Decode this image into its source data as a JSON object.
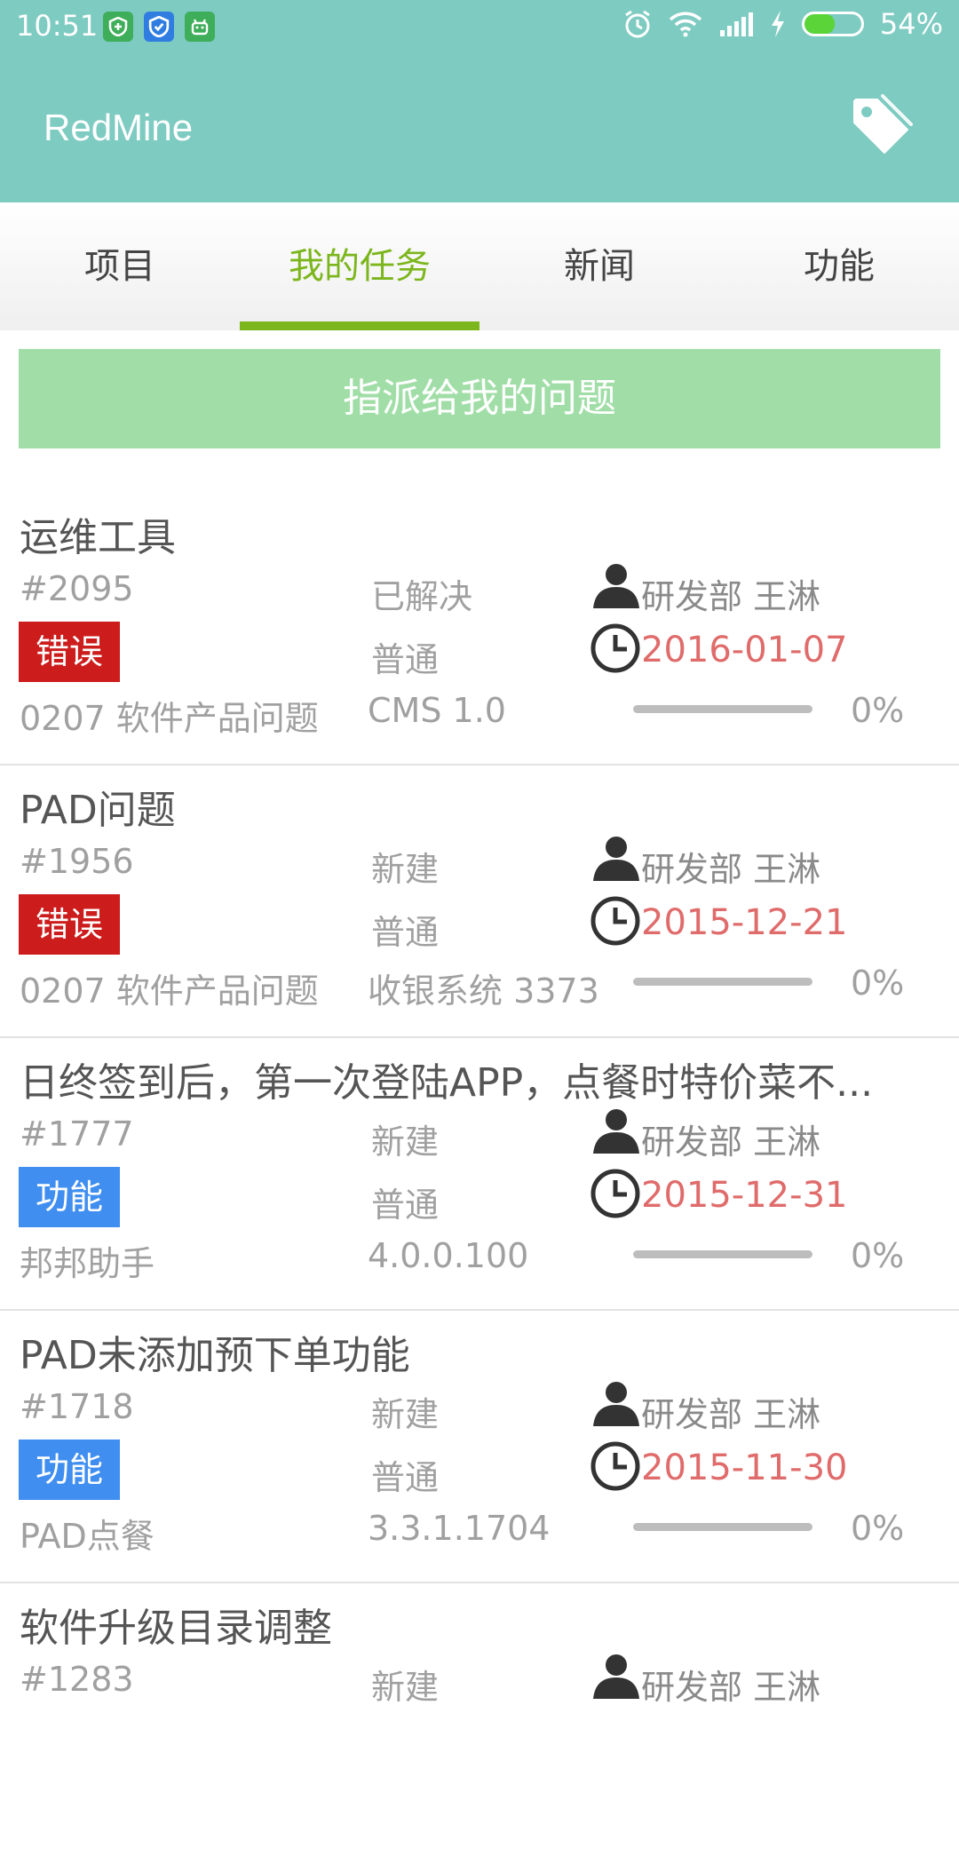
{
  "status_bar": {
    "time": "10:51",
    "battery_text": "54%",
    "battery_level": 0.54,
    "left_icons": [
      "shield-plus-icon",
      "shield-check-icon",
      "android-icon"
    ],
    "right_icons": [
      "alarm-icon",
      "wifi-icon",
      "signal-icon",
      "charging-icon",
      "battery-icon"
    ]
  },
  "app_bar": {
    "title": "RedMine",
    "action_icon": "tag-icon",
    "color": "#7ecbc2"
  },
  "tabs": [
    {
      "label": "项目",
      "active": false
    },
    {
      "label": "我的任务",
      "active": true
    },
    {
      "label": "新闻",
      "active": false
    },
    {
      "label": "功能",
      "active": false
    }
  ],
  "accent_color": "#7cb61d",
  "section_header": "指派给我的问题",
  "issues": [
    {
      "title": "运维工具",
      "id": "#2095",
      "status": "已解决",
      "assignee": "研发部 王淋",
      "tracker": "错误",
      "tracker_color": "#cc1c1c",
      "priority": "普通",
      "due_date": "2016-01-07",
      "project": "0207 软件产品问题",
      "version": "CMS 1.0",
      "progress": 0,
      "progress_text": "0%"
    },
    {
      "title": "PAD问题",
      "id": "#1956",
      "status": "新建",
      "assignee": "研发部 王淋",
      "tracker": "错误",
      "tracker_color": "#cc1c1c",
      "priority": "普通",
      "due_date": "2015-12-21",
      "project": "0207 软件产品问题",
      "version": "收银系统 3373",
      "progress": 0,
      "progress_text": "0%"
    },
    {
      "title": "日终签到后，第一次登陆APP，点餐时特价菜不...",
      "id": "#1777",
      "status": "新建",
      "assignee": "研发部 王淋",
      "tracker": "功能",
      "tracker_color": "#3f8ef0",
      "priority": "普通",
      "due_date": "2015-12-31",
      "project": "邦邦助手",
      "version": "4.0.0.100",
      "progress": 0,
      "progress_text": "0%"
    },
    {
      "title": "PAD未添加预下单功能",
      "id": "#1718",
      "status": "新建",
      "assignee": "研发部 王淋",
      "tracker": "功能",
      "tracker_color": "#3f8ef0",
      "priority": "普通",
      "due_date": "2015-11-30",
      "project": "PAD点餐",
      "version": "3.3.1.1704",
      "progress": 0,
      "progress_text": "0%"
    },
    {
      "title": "软件升级目录调整",
      "id": "#1283",
      "status": "新建",
      "assignee": "研发部 王淋"
    }
  ]
}
